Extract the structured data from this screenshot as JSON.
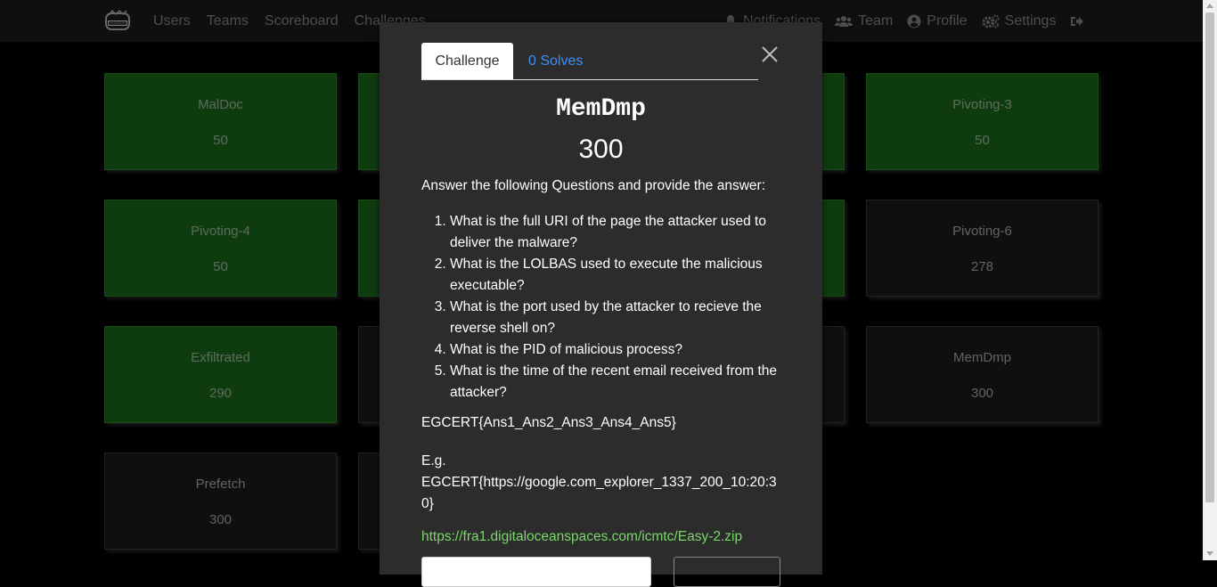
{
  "navbar": {
    "left_links": [
      "Users",
      "Teams",
      "Scoreboard",
      "Challenges"
    ],
    "notifications": "Notifications",
    "team": "Team",
    "profile": "Profile",
    "settings": "Settings"
  },
  "challenges": [
    {
      "name": "MalDoc",
      "value": "50",
      "solved": true
    },
    {
      "name": "",
      "value": "",
      "solved": true
    },
    {
      "name": "",
      "value": "",
      "solved": true
    },
    {
      "name": "Pivoting-3",
      "value": "50",
      "solved": true
    },
    {
      "name": "Pivoting-4",
      "value": "50",
      "solved": true
    },
    {
      "name": "",
      "value": "",
      "solved": true
    },
    {
      "name": "",
      "value": "",
      "solved": true
    },
    {
      "name": "Pivoting-6",
      "value": "278",
      "solved": false
    },
    {
      "name": "Exfiltrated",
      "value": "290",
      "solved": true
    },
    {
      "name": "",
      "value": "",
      "solved": false
    },
    {
      "name": "",
      "value": "",
      "solved": false
    },
    {
      "name": "MemDmp",
      "value": "300",
      "solved": false
    },
    {
      "name": "Prefetch",
      "value": "300",
      "solved": false
    },
    {
      "name": "",
      "value": "",
      "solved": false
    }
  ],
  "modal": {
    "tab_challenge": "Challenge",
    "tab_solves": "0 Solves",
    "title": "MemDmp",
    "points": "300",
    "intro": "Answer the following Questions and provide the answer:",
    "questions": [
      "What is the full URI of the page the attacker used to deliver the malware?",
      "What is the LOLBAS used to execute the malicious executable?",
      "What is the port used by the attacker to recieve the reverse shell on?",
      "What is the PID of malicious process?",
      "What is the time of the recent email received from the attacker?"
    ],
    "flag_format": "EGCERT{Ans1_Ans2_Ans3_Ans4_Ans5}",
    "example_label": "E.g.",
    "example_value": "EGCERT{https://google.com_explorer_1337_200_10:20:30}",
    "download_link": "https://fra1.digitaloceanspaces.com/icmtc/Easy-2.zip"
  },
  "colors": {
    "solved": "#1d6e1d",
    "unsolved": "#1b1c1e",
    "link": "#3f8ff5",
    "download": "#7bd66b"
  }
}
